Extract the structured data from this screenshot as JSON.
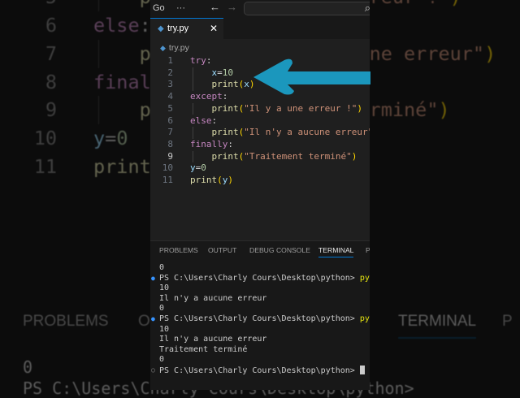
{
  "titlebar": {
    "menu_go": "Go",
    "more": "···",
    "back": "←",
    "forward": "→",
    "search_icon": "⌕"
  },
  "tab": {
    "name": "try.py",
    "close": "✕"
  },
  "breadcrumb": "try.py",
  "code": [
    {
      "n": "1",
      "t": [
        [
          "try",
          "kw"
        ],
        [
          ":",
          "pl"
        ]
      ]
    },
    {
      "n": "2",
      "t": [
        [
          "    ",
          "pl"
        ],
        [
          "x",
          "var"
        ],
        [
          "=",
          "pl"
        ],
        [
          "10",
          "num"
        ]
      ]
    },
    {
      "n": "3",
      "t": [
        [
          "    ",
          "pl"
        ],
        [
          "print",
          "fn"
        ],
        [
          "(",
          "par"
        ],
        [
          "x",
          "var"
        ],
        [
          ")",
          "par"
        ]
      ]
    },
    {
      "n": "4",
      "t": [
        [
          "except",
          "kw"
        ],
        [
          ":",
          "pl"
        ]
      ]
    },
    {
      "n": "5",
      "t": [
        [
          "    ",
          "pl"
        ],
        [
          "print",
          "fn"
        ],
        [
          "(",
          "par"
        ],
        [
          "\"Il y a une erreur !\"",
          "str"
        ],
        [
          ")",
          "par"
        ]
      ]
    },
    {
      "n": "6",
      "t": [
        [
          "else",
          "kw"
        ],
        [
          ":",
          "pl"
        ]
      ]
    },
    {
      "n": "7",
      "t": [
        [
          "    ",
          "pl"
        ],
        [
          "print",
          "fn"
        ],
        [
          "(",
          "par"
        ],
        [
          "\"Il n'y a aucune erreur\"",
          "str"
        ],
        [
          ")",
          "par"
        ]
      ]
    },
    {
      "n": "8",
      "t": [
        [
          "finally",
          "kw"
        ],
        [
          ":",
          "pl"
        ]
      ]
    },
    {
      "n": "9",
      "t": [
        [
          "    ",
          "pl"
        ],
        [
          "print",
          "fn"
        ],
        [
          "(",
          "par"
        ],
        [
          "\"Traitement terminé\"",
          "str"
        ],
        [
          ")",
          "par"
        ]
      ]
    },
    {
      "n": "10",
      "t": [
        [
          "y",
          "var"
        ],
        [
          "=",
          "pl"
        ],
        [
          "0",
          "num"
        ]
      ]
    },
    {
      "n": "11",
      "t": [
        [
          "print",
          "fn"
        ],
        [
          "(",
          "par"
        ],
        [
          "y",
          "var"
        ],
        [
          ")",
          "par"
        ]
      ]
    }
  ],
  "current_line": "9",
  "panel": {
    "tabs": [
      "PROBLEMS",
      "OUTPUT",
      "DEBUG CONSOLE",
      "TERMINAL",
      "P"
    ],
    "active": "TERMINAL"
  },
  "terminal": {
    "prompt": "PS C:\\Users\\Charly Cours\\Desktop\\python> ",
    "cmd": "py t",
    "lines": [
      "0",
      "PROMPT_CMD",
      "10",
      "Il n'y a aucune erreur",
      "0",
      "PROMPT_CMD",
      "10",
      "Il n'y a aucune erreur",
      "Traitement terminé",
      "0",
      "PROMPT_END"
    ]
  },
  "colors": {
    "arrow": "#1b97bd",
    "accent": "#0078d4"
  }
}
